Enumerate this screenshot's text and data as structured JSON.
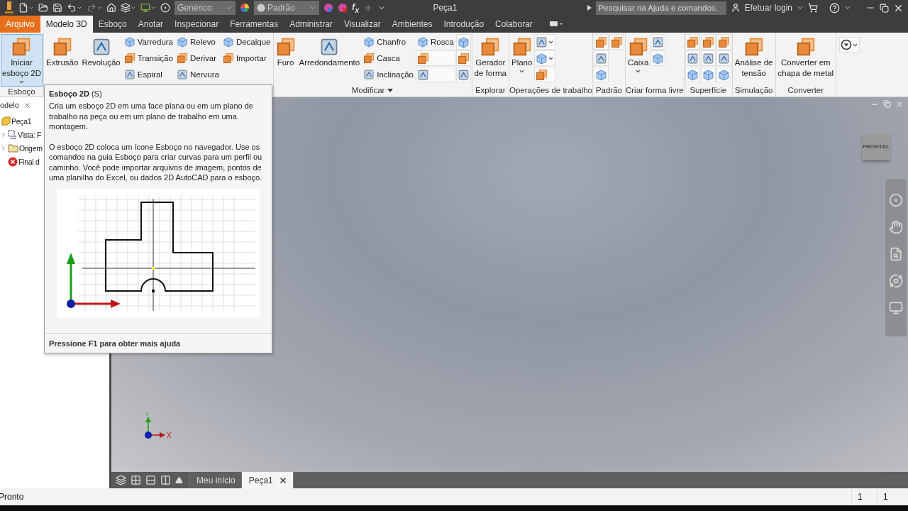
{
  "title_bar": {
    "material": "Genérico",
    "appearance": "Padrão",
    "function_label": "f$_{x}$",
    "title": "Peça1",
    "search": {
      "placeholder": "Pesquisar na Ajuda e comandos."
    },
    "login": "Efetuar login"
  },
  "menu_tabs": [
    {
      "kind": "file",
      "label": "Arquivo",
      "selected": false
    },
    {
      "kind": "tab",
      "label": "Modelo 3D",
      "selected": true
    },
    {
      "kind": "tab",
      "label": "Esboço",
      "selected": false
    },
    {
      "kind": "tab",
      "label": "Anotar",
      "selected": false
    },
    {
      "kind": "tab",
      "label": "Inspecionar",
      "selected": false
    },
    {
      "kind": "tab",
      "label": "Ferramentas",
      "selected": false
    },
    {
      "kind": "tab",
      "label": "Administrar",
      "selected": false
    },
    {
      "kind": "tab",
      "label": "Visualizar",
      "selected": false
    },
    {
      "kind": "tab",
      "label": "Ambientes",
      "selected": false
    },
    {
      "kind": "tab",
      "label": "Introdução",
      "selected": false
    },
    {
      "kind": "tab",
      "label": "Colaborar",
      "selected": false
    }
  ],
  "ribbon": {
    "panels": [
      {
        "label": "Esboço",
        "items": [
          {
            "kind": "large",
            "lines": [
              "Iniciar",
              "esboço 2D"
            ],
            "dropdown": true,
            "highlighted": true
          }
        ]
      },
      {
        "items": [
          {
            "kind": "large",
            "lines": [
              "Extrusão"
            ]
          },
          {
            "kind": "large",
            "lines": [
              "Revolução"
            ]
          },
          {
            "kind": "column",
            "items": [
              {
                "kind": "labeled",
                "label": "Varredura"
              },
              {
                "kind": "labeled",
                "label": "Transição"
              },
              {
                "kind": "labeled",
                "label": "Espiral"
              }
            ]
          },
          {
            "kind": "column",
            "items": [
              {
                "kind": "labeled",
                "label": "Relevo"
              },
              {
                "kind": "labeled",
                "label": "Derivar"
              },
              {
                "kind": "labeled",
                "label": "Nervura"
              }
            ]
          },
          {
            "kind": "column",
            "items": [
              {
                "kind": "labeled",
                "label": "Decalque"
              },
              {
                "kind": "labeled",
                "label": "Importar"
              }
            ]
          }
        ]
      },
      {
        "label": "Modificar",
        "menu": true,
        "items": [
          {
            "kind": "large",
            "lines": [
              "Furo"
            ]
          },
          {
            "kind": "large",
            "lines": [
              "Arredondamento"
            ]
          },
          {
            "kind": "column",
            "items": [
              {
                "kind": "labeled",
                "label": "Chanfro"
              },
              {
                "kind": "labeled",
                "label": "Casca"
              },
              {
                "kind": "labeled",
                "label": "Inclinação"
              }
            ]
          },
          {
            "kind": "column",
            "items": [
              {
                "kind": "labeled",
                "label": "Rosca"
              },
              {
                "kind": "icon"
              },
              {
                "kind": "icon"
              }
            ]
          },
          {
            "kind": "column",
            "items": [
              {
                "kind": "icon"
              },
              {
                "kind": "icon"
              },
              {
                "kind": "icon"
              }
            ]
          }
        ]
      },
      {
        "label": "Explorar",
        "items": [
          {
            "kind": "large",
            "lines": [
              "Gerador",
              "de forma"
            ]
          }
        ]
      },
      {
        "label": "Operações de trabalho",
        "items": [
          {
            "kind": "large",
            "lines": [
              "Plano"
            ],
            "dropdown": true
          },
          {
            "kind": "column",
            "items": [
              {
                "kind": "icon",
                "dropdown": true
              },
              {
                "kind": "icon",
                "dropdown": true
              },
              {
                "kind": "icon"
              }
            ]
          }
        ]
      },
      {
        "label": "Padrão",
        "items": [
          {
            "kind": "column",
            "items": [
              {
                "kind": "icon"
              },
              {
                "kind": "icon"
              },
              {
                "kind": "icon"
              }
            ]
          },
          {
            "kind": "column",
            "items": [
              {
                "kind": "icon"
              }
            ]
          }
        ]
      },
      {
        "label": "Criar forma livre",
        "items": [
          {
            "kind": "large",
            "lines": [
              "Caixa"
            ],
            "dropdown": true
          },
          {
            "kind": "column",
            "items": [
              {
                "kind": "icon"
              },
              {
                "kind": "icon"
              }
            ]
          }
        ]
      },
      {
        "label": "Superfície",
        "items": [
          {
            "kind": "column",
            "items": [
              {
                "kind": "icon"
              },
              {
                "kind": "icon"
              },
              {
                "kind": "icon"
              }
            ]
          },
          {
            "kind": "column",
            "items": [
              {
                "kind": "icon"
              },
              {
                "kind": "icon"
              },
              {
                "kind": "icon"
              }
            ]
          },
          {
            "kind": "column",
            "items": [
              {
                "kind": "icon"
              },
              {
                "kind": "icon"
              },
              {
                "kind": "icon"
              }
            ]
          }
        ]
      },
      {
        "label": "Simulação",
        "items": [
          {
            "kind": "large",
            "lines": [
              "Análise de",
              "tensão"
            ]
          }
        ]
      },
      {
        "label": "Converter",
        "items": [
          {
            "kind": "large",
            "lines": [
              "Converter em",
              "chapa de metal"
            ]
          }
        ]
      }
    ]
  },
  "browser": {
    "title": "odelo",
    "tree": [
      {
        "kind": "part",
        "label": "Peça1",
        "children": [
          {
            "kind": "view",
            "label": "Vista: F",
            "expandable": true
          },
          {
            "kind": "folder",
            "label": "Origem",
            "expandable": true
          },
          {
            "kind": "end",
            "label": "Final d",
            "expandable": false
          }
        ]
      }
    ]
  },
  "tooltip": {
    "title": "**Esboço 2D** (S)",
    "paragraphs": [
      "Cria um esboço 2D em uma face plana ou em um plano de trabalho na peça ou em um plano de trabalho em uma montagem.",
      "O esboço 2D coloca um ícone Esboço no navegador. Use os comandos na guia Esboço para criar curvas para um perfil ou caminho. Você pode importar arquivos de imagem, pontos de uma planilha do Excel, ou dados 2D AutoCAD para o esboço."
    ],
    "footer": "Pressione F1 para obter mais ajuda"
  },
  "viewport": {
    "view_cube": "FRONTAL",
    "axis_x": "X",
    "axis_y": "Y"
  },
  "document_tabs": [
    {
      "label": "Meu início",
      "selected": false
    },
    {
      "label": "Peça1",
      "selected": true
    }
  ],
  "status_bar": {
    "message": "Pronto",
    "fields": [
      "1",
      "1"
    ]
  }
}
